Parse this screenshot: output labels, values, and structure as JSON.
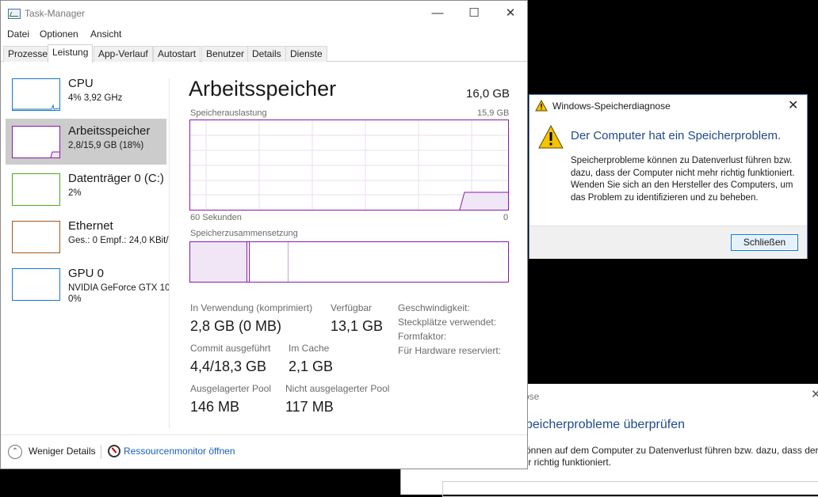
{
  "background_dialog": {
    "title_fragment": "ose",
    "heading_fragment": "peicherprobleme überprüfen",
    "text_line1": "önnen auf dem Computer zu Datenverlust führen bzw. dazu, dass der",
    "text_line2": "ır richtig funktioniert."
  },
  "taskmanager": {
    "title": "Task-Manager",
    "window_buttons": {
      "minimize": "—",
      "maximize": "☐",
      "close": "✕"
    },
    "menu": [
      "Datei",
      "Optionen",
      "Ansicht"
    ],
    "tabs": [
      "Prozesse",
      "Leistung",
      "App-Verlauf",
      "Autostart",
      "Benutzer",
      "Details",
      "Dienste"
    ],
    "active_tab": "Leistung",
    "sidebar": [
      {
        "name": "CPU",
        "sub": "4% 3,92 GHz",
        "sub2": "",
        "color": "#1778c9"
      },
      {
        "name": "Arbeitsspeicher",
        "sub": "2,8/15,9 GB (18%)",
        "sub2": "",
        "color": "#8b1aa8"
      },
      {
        "name": "Datenträger 0 (C:)",
        "sub": "2%",
        "sub2": "",
        "color": "#4da71c"
      },
      {
        "name": "Ethernet",
        "sub": "Ges.: 0 Empf.: 24,0 KBit/",
        "sub2": "",
        "color": "#a7571c"
      },
      {
        "name": "GPU 0",
        "sub": "NVIDIA GeForce GTX 10",
        "sub2": "0%",
        "color": "#1778c9"
      }
    ],
    "main": {
      "title": "Arbeitsspeicher",
      "total": "16,0 GB",
      "usage_label": "Speicherauslastung",
      "usage_max": "15,9 GB",
      "time_left": "60 Sekunden",
      "time_right": "0",
      "composition_label": "Speicherzusammensetzung",
      "stats": {
        "in_use_label": "In Verwendung (komprimiert)",
        "in_use_value": "2,8 GB (0 MB)",
        "available_label": "Verfügbar",
        "available_value": "13,1 GB",
        "commit_label": "Commit ausgeführt",
        "commit_value": "4,4/18,3 GB",
        "cached_label": "Im Cache",
        "cached_value": "2,1 GB",
        "paged_label": "Ausgelagerter Pool",
        "paged_value": "146 MB",
        "nonpaged_label": "Nicht ausgelagerter Pool",
        "nonpaged_value": "117 MB"
      },
      "right_labels": [
        "Geschwindigkeit:",
        "Steckplätze verwendet:",
        "Formfaktor:",
        "Für Hardware reserviert:"
      ],
      "usage_fraction": 0.18
    },
    "footer": {
      "fewer_details": "Weniger Details",
      "resource_monitor": "Ressourcenmonitor öffnen"
    }
  },
  "memdiag": {
    "title": "Windows-Speicherdiagnose",
    "heading": "Der Computer hat ein Speicherproblem.",
    "body": "Speicherprobleme können zu Datenverlust führen bzw. dazu, dass der Computer nicht mehr richtig funktioniert. Wenden Sie sich an den Hersteller des Computers, um das Problem zu identifizieren und zu beheben.",
    "close_button": "Schließen",
    "close_icon": "✕"
  }
}
